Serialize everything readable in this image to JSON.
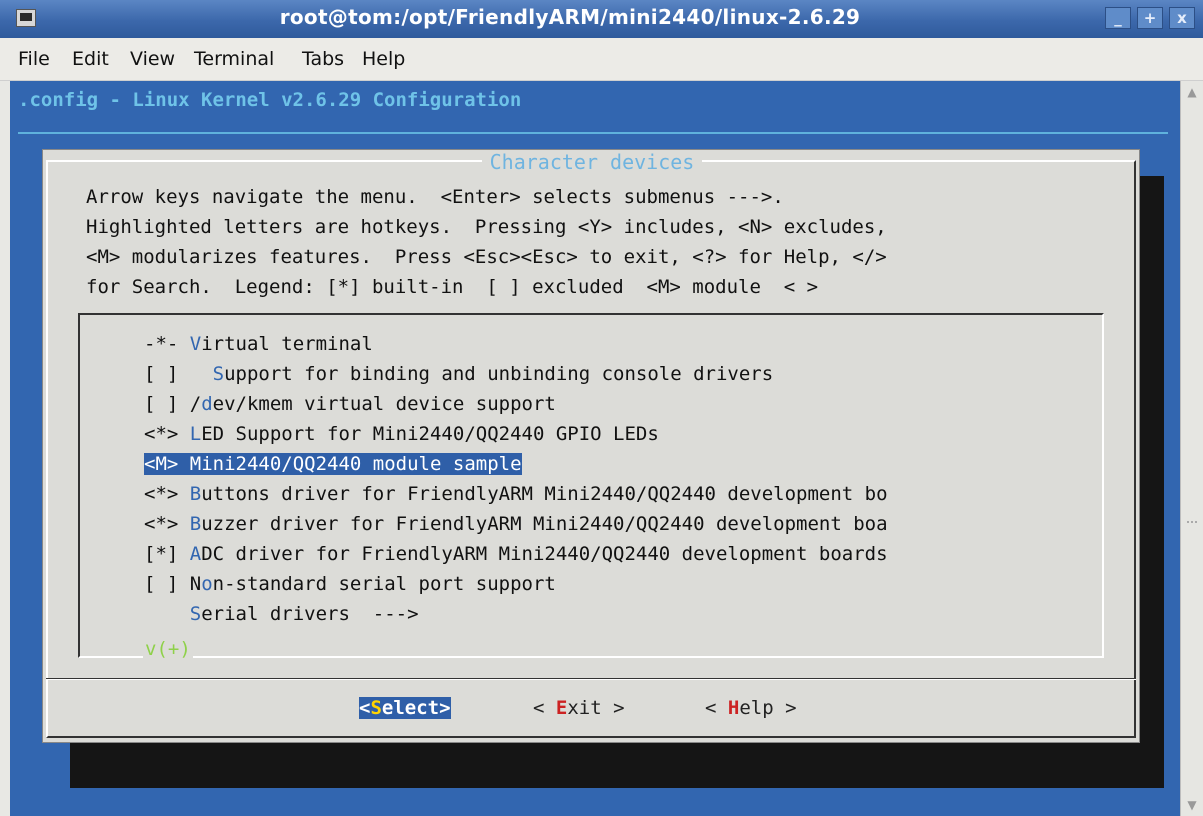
{
  "window": {
    "title": "root@tom:/opt/FriendlyARM/mini2440/linux-2.6.29",
    "buttons": [
      "_",
      "+",
      "x"
    ]
  },
  "menubar": [
    "File",
    "Edit",
    "View",
    "Terminal",
    "Tabs",
    "Help"
  ],
  "config_title": ".config - Linux Kernel v2.6.29 Configuration",
  "dialog": {
    "title": "Character devices",
    "help_lines": [
      "Arrow keys navigate the menu.  <Enter> selects submenus --->.",
      "Highlighted letters are hotkeys.  Pressing <Y> includes, <N> excludes,",
      "<M> modularizes features.  Press <Esc><Esc> to exit, <?> for Help, </>",
      "for Search.  Legend: [*] built-in  [ ] excluded  <M> module  < >"
    ],
    "items": [
      {
        "prefix": "-*- ",
        "hotkey": "V",
        "rest": "irtual terminal",
        "selected": false
      },
      {
        "prefix": "[ ]   ",
        "hotkey": "S",
        "rest": "upport for binding and unbinding console drivers",
        "selected": false
      },
      {
        "prefix": "[ ] /",
        "hotkey": "d",
        "rest": "ev/kmem virtual device support",
        "selected": false
      },
      {
        "prefix": "<*> ",
        "hotkey": "L",
        "rest": "ED Support for Mini2440/QQ2440 GPIO LEDs",
        "selected": false
      },
      {
        "prefix": "<M> ",
        "hotkey": "M",
        "rest": "ini2440/QQ2440 module sample",
        "selected": true
      },
      {
        "prefix": "<*> ",
        "hotkey": "B",
        "rest": "uttons driver for FriendlyARM Mini2440/QQ2440 development bo",
        "selected": false
      },
      {
        "prefix": "<*> ",
        "hotkey": "B",
        "rest": "uzzer driver for FriendlyARM Mini2440/QQ2440 development boa",
        "selected": false
      },
      {
        "prefix": "[*] ",
        "hotkey": "A",
        "rest": "DC driver for FriendlyARM Mini2440/QQ2440 development boards",
        "selected": false
      },
      {
        "prefix": "[ ] N",
        "hotkey": "o",
        "rest": "n-standard serial port support",
        "selected": false
      },
      {
        "prefix": "    ",
        "hotkey": "S",
        "rest": "erial drivers  --->",
        "selected": false
      }
    ],
    "more_indicator": "v(+)",
    "buttons": [
      {
        "pre": "<",
        "hotkey": "S",
        "post": "elect>",
        "selected": true
      },
      {
        "pre": "< ",
        "hotkey": "E",
        "post": "xit >",
        "selected": false
      },
      {
        "pre": "< ",
        "hotkey": "H",
        "post": "elp >",
        "selected": false
      }
    ]
  },
  "colors": {
    "terminal_bg": "#3266b0",
    "dialog_bg": "#dcdcd8",
    "highlight": "#2f5fa8",
    "title_cyan": "#6fc3e8"
  }
}
